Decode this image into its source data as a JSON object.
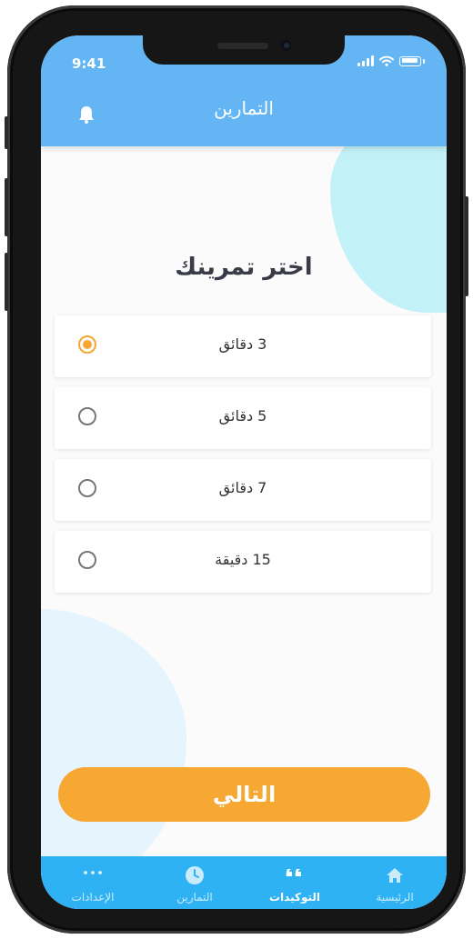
{
  "status_bar": {
    "time": "9:41"
  },
  "header": {
    "title": "التمارين"
  },
  "main": {
    "title": "اختر تمرينك",
    "options": [
      {
        "label": "3 دقائق",
        "selected": true
      },
      {
        "label": "5 دقائق",
        "selected": false
      },
      {
        "label": "7 دقائق",
        "selected": false
      },
      {
        "label": "15 دقيقة",
        "selected": false
      }
    ],
    "next_button": "التالي"
  },
  "tabbar": {
    "items": [
      {
        "label": "الإعدادات",
        "icon": "more-icon",
        "active": false
      },
      {
        "label": "التمارين",
        "icon": "clock-icon",
        "active": false
      },
      {
        "label": "التوكيدات",
        "icon": "quote-icon",
        "active": true
      },
      {
        "label": "الرئيسية",
        "icon": "home-icon",
        "active": false
      }
    ]
  },
  "colors": {
    "header": "#64b5f3",
    "accent": "#f7a833",
    "tabbar": "#2fb2f3",
    "blob_top": "#c3f1f8",
    "blob_bottom": "#e6f4fd"
  }
}
